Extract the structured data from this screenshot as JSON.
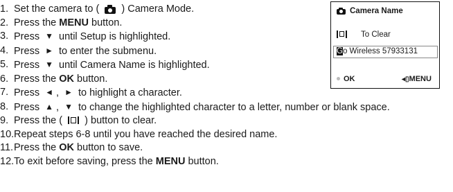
{
  "steps": [
    {
      "n": "1.",
      "a": "Set the camera to (",
      "b": ") Camera Mode."
    },
    {
      "n": "2.",
      "a": "Press the ",
      "bold": "MENU",
      "b": " button."
    },
    {
      "n": "3.",
      "a": "Press",
      "b": "until Setup is highlighted."
    },
    {
      "n": "4.",
      "a": "Press",
      "b": "to enter the submenu."
    },
    {
      "n": "5.",
      "a": "Press",
      "b": "until Camera Name is highlighted."
    },
    {
      "n": "6.",
      "a": "Press the ",
      "bold": "OK",
      "b": " button."
    },
    {
      "n": "7.",
      "a": "Press",
      "sep": ",",
      "b": "to highlight a character."
    },
    {
      "n": "8.",
      "a": "Press",
      "sep": ",",
      "b": "to change the highlighted character to a letter, number or blank space."
    },
    {
      "n": "9.",
      "a": "Press the (",
      "b": ") button to clear."
    },
    {
      "n": "10.",
      "a": "Repeat steps  6-8 until you have reached the desired name."
    },
    {
      "n": "11.",
      "a": "Press the ",
      "bold": "OK",
      "b": " button to save."
    },
    {
      "n": "12.",
      "a": "To exit before saving, press the ",
      "bold": "MENU",
      "b": " button."
    }
  ],
  "symbols": {
    "down": "▼",
    "right": "►",
    "left": "◄",
    "up": "▲"
  },
  "lcd": {
    "title": "Camera Name",
    "clear_label": "To Clear",
    "name_highlight": "G",
    "name_rest": "o Wireless 57933131",
    "ok_label": "OK",
    "menu_arrow": "◂▯",
    "menu_label": "MENU"
  },
  "icons": [
    "camera-icon",
    "clear-icon",
    "down-arrow-icon",
    "right-arrow-icon",
    "left-arrow-icon",
    "up-arrow-icon"
  ]
}
